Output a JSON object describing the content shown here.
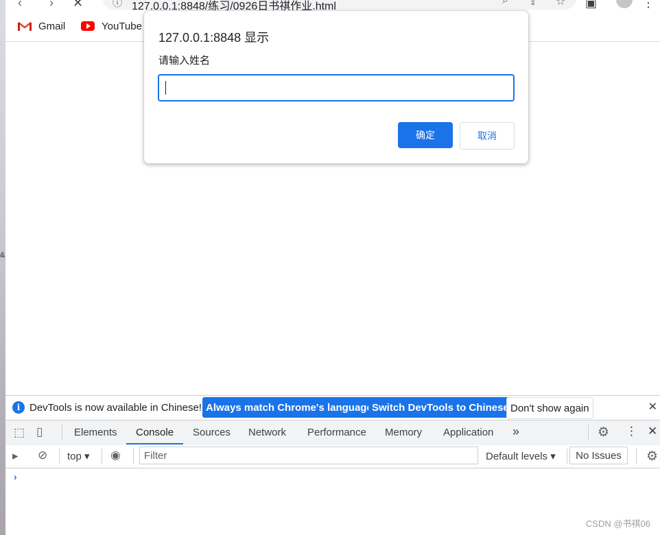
{
  "browser": {
    "url": "127.0.0.1:8848/练习/0926日书祺作业.html"
  },
  "bookmarks": [
    {
      "label": "Gmail",
      "icon": "gmail-icon"
    },
    {
      "label": "YouTube",
      "icon": "youtube-icon"
    }
  ],
  "dialog": {
    "title": "127.0.0.1:8848 显示",
    "message": "请输入姓名",
    "input_value": "",
    "ok_label": "确定",
    "cancel_label": "取消"
  },
  "devtools": {
    "infobar": {
      "message": "DevTools is now available in Chinese!",
      "match_language_label": "Always match Chrome's language",
      "switch_chinese_label": "Switch DevTools to Chinese",
      "dont_show_label": "Don't show again"
    },
    "tabs": [
      "Elements",
      "Console",
      "Sources",
      "Network",
      "Performance",
      "Memory",
      "Application"
    ],
    "active_tab": "Console",
    "more_tabs": "»",
    "console": {
      "context": "top",
      "filter_placeholder": "Filter",
      "levels": "Default levels",
      "issues": "No Issues",
      "prompt": "›"
    }
  },
  "watermark": "CSDN @书祺06",
  "colors": {
    "accent": "#1a73e8",
    "youtube_red": "#ff0000"
  }
}
